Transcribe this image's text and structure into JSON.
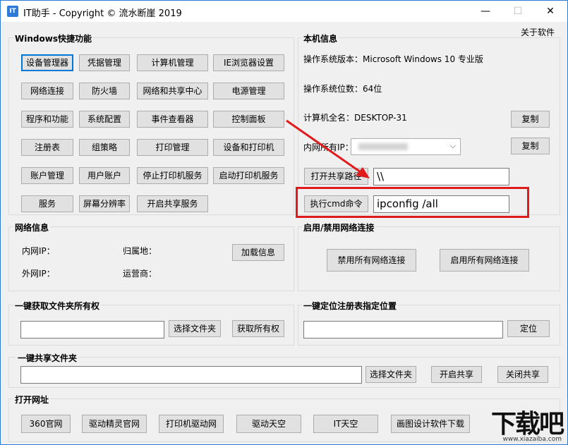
{
  "window": {
    "title": "IT助手 - Copyright © 流水断崖 2019",
    "app_icon": "IT",
    "minimize": "—",
    "maximize": "☐",
    "close": "✕"
  },
  "about": "关于软件",
  "shortcuts": {
    "title": "Windows快捷功能",
    "buttons": [
      "设备管理器",
      "凭据管理",
      "计算机管理",
      "IE浏览器设置",
      "网络连接",
      "防火墙",
      "网络和共享中心",
      "电源管理",
      "程序和功能",
      "系统配置",
      "事件查看器",
      "控制面板",
      "注册表",
      "组策略",
      "打印管理",
      "设备和打印机",
      "账户管理",
      "用户账户",
      "停止打印机服务",
      "启动打印机服务",
      "服务",
      "屏幕分辨率",
      "开启共享服务"
    ]
  },
  "sysinfo": {
    "title": "本机信息",
    "os_version": "操作系统版本：Microsoft Windows 10 专业版",
    "os_bits": "操作系统位数：64位",
    "computer_name": "计算机全名：DESKTOP-31",
    "copy1": "复制",
    "lan_ip_label": "内网所有IP：",
    "copy2": "复制",
    "open_share_path": "打开共享路径",
    "share_path_value": "\\\\",
    "run_cmd": "执行cmd命令",
    "cmd_value": "ipconfig /all"
  },
  "netinfo": {
    "title": "网络信息",
    "lan_ip": "内网IP：",
    "wan_ip": "外网IP：",
    "location": "归属地：",
    "isp": "运营商：",
    "load_btn": "加载信息"
  },
  "netconn": {
    "title": "启用/禁用网络连接",
    "disable_all": "禁用所有网络连接",
    "enable_all": "启用所有网络连接"
  },
  "ownership": {
    "title": "一键获取文件夹所有权",
    "select": "选择文件夹",
    "take": "获取所有权",
    "value": ""
  },
  "regjump": {
    "title": "一键定位注册表指定位置",
    "locate": "定位",
    "value": ""
  },
  "share": {
    "title": "一键共享文件夹",
    "select": "选择文件夹",
    "start": "开启共享",
    "stop": "关闭共享",
    "value": ""
  },
  "urls": {
    "title": "打开网址",
    "buttons": [
      "360官网",
      "驱动精灵官网",
      "打印机驱动网",
      "驱动天空",
      "IT天空",
      "画图设计软件下载"
    ]
  },
  "watermark": {
    "brand": "下载吧",
    "domain": "www.xiazaiba.com"
  },
  "colors": {
    "accent": "#0078d7",
    "highlight": "#e01b1b",
    "window_bg": "#f0f0f0"
  }
}
